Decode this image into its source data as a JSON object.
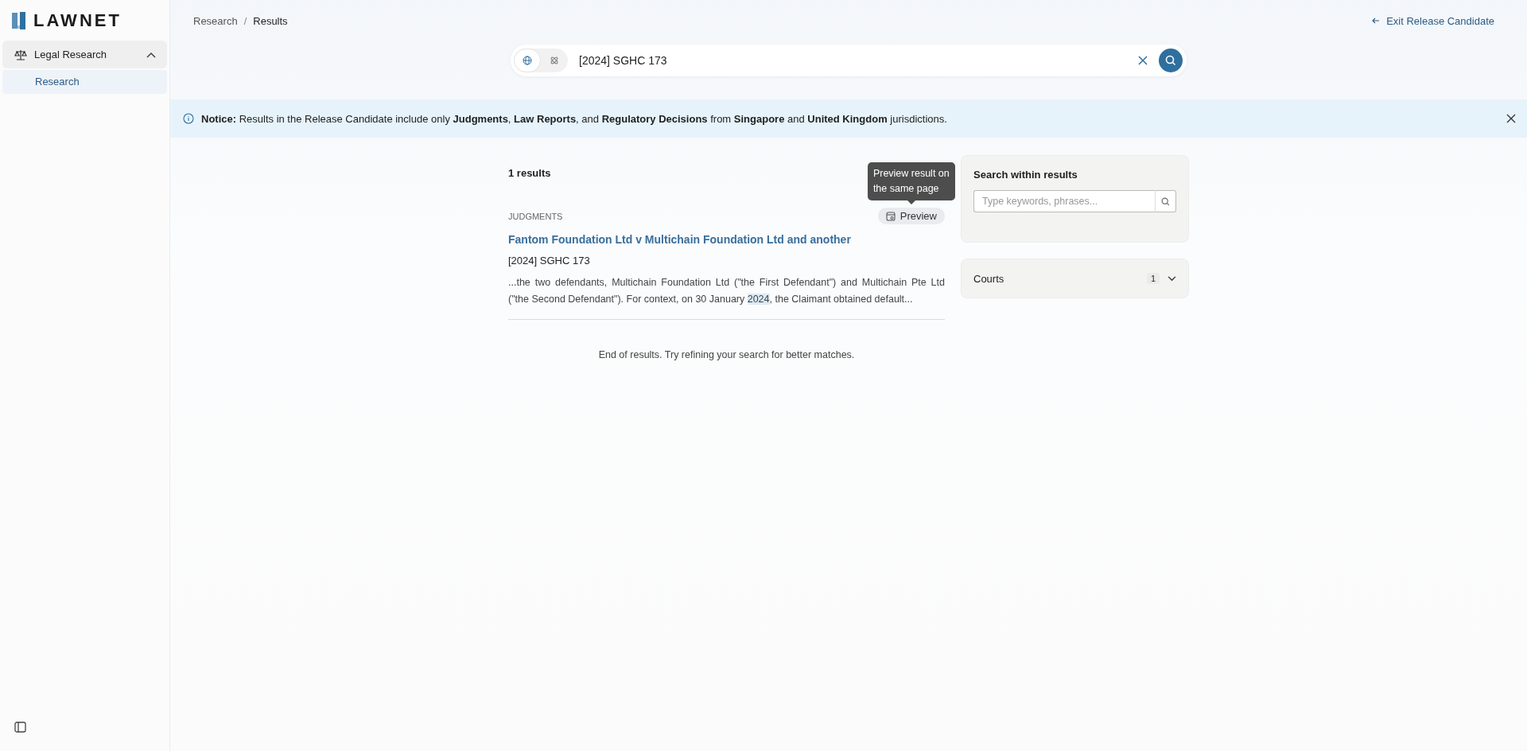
{
  "sidebar": {
    "logo": "LAWNET",
    "items": [
      {
        "label": "Legal Research",
        "expanded": true,
        "children": [
          {
            "label": "Research",
            "selected": true
          }
        ]
      }
    ]
  },
  "breadcrumb": [
    "Research",
    "Results"
  ],
  "breadcrumb_separator": "/",
  "exit_link": "Exit Release Candidate",
  "search": {
    "scopes": [
      {
        "kind": "globe",
        "selected": true
      },
      {
        "kind": "atom",
        "selected": false
      }
    ],
    "value": "[2024] SGHC 173"
  },
  "notice": "**Notice:** Results in the Release Candidate include only **Judgments**, **Law Reports**, and **Regulatory Decisions** from **Singapore** and **United Kingdom** jurisdictions.",
  "results": {
    "count": "1 results",
    "items": [
      {
        "category": "JUDGMENTS",
        "preview_button": "Preview",
        "tooltip": "Preview result on the same page",
        "title": "Fantom Foundation Ltd v Multichain Foundation Ltd and another",
        "citation": "[2024] SGHC 173",
        "snippet": [
          {
            "text": "...the two defendants, Multichain Foundation Ltd (\"the First Defendant\") and Multichain Pte Ltd (\"the Second Defendant\"). For context, on 30 January ",
            "highlighted": false
          },
          {
            "text": "2024",
            "highlighted": true
          },
          {
            "text": ", the Claimant obtained default...",
            "highlighted": false
          }
        ]
      }
    ],
    "end_message": "End of results. Try refining your search for better matches."
  },
  "filters": {
    "search_within": {
      "title": "Search within results",
      "placeholder": "Type keywords, phrases..."
    },
    "facets": [
      {
        "label": "Courts",
        "count": "1",
        "expanded": false
      }
    ]
  }
}
